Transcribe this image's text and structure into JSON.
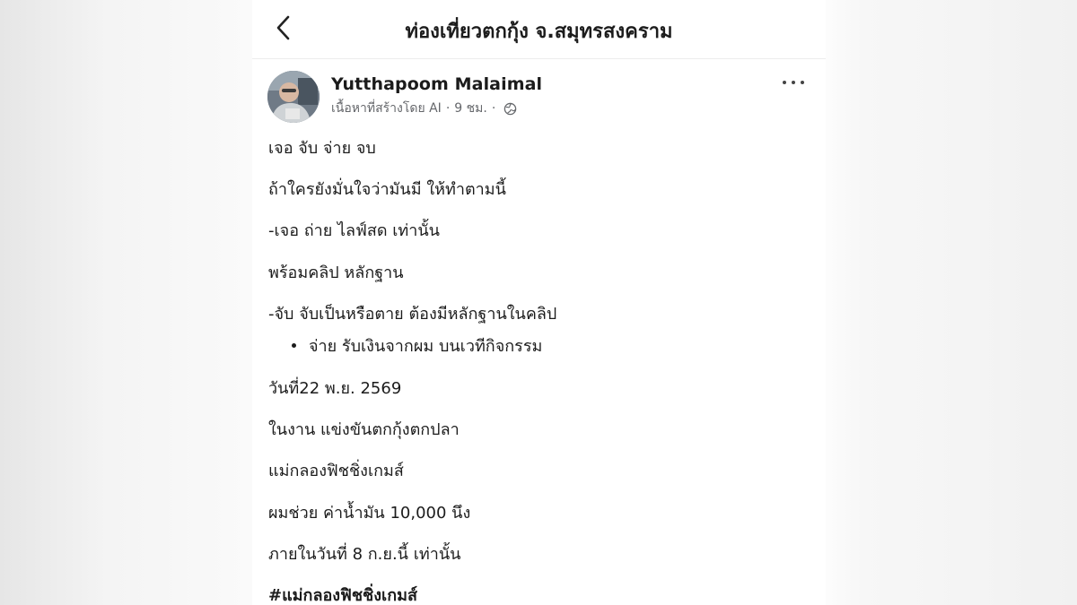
{
  "topbar": {
    "back_icon": "chevron-left-icon",
    "title": "ท่องเที่ยวตกกุ้ง จ.สมุทรสงคราม"
  },
  "post": {
    "author": "Yutthapoom Malaimal",
    "ai_label": "เนื้อหาที่สร้างโดย AI",
    "time": "9 ชม.",
    "separator": "·",
    "privacy_icon": "globe-icon",
    "more_icon": "more-horizontal-icon",
    "lines": [
      "เจอ  จับ  จ่าย  จบ",
      "ถ้าใครยังมั่นใจว่ามันมี  ให้ทำตามนี้",
      "-เจอ   ถ่าย ไลฟ์สด เท่านั้น",
      "พร้อมคลิป หลักฐาน",
      "-จับ    จับเป็นหรือตาย ต้องมีหลักฐานในคลิป",
      "จ่าย   รับเงินจากผม บนเวทีกิจกรรม",
      "วันที่22 พ.ย. 2569",
      "ในงาน แข่งขันตกกุ้งตกปลา",
      "แม่กลองฟิชชิ่งเกมส์",
      "ผมช่วย ค่าน้ำมัน 10,000 นึง",
      "ภายในวันที่ 8 ก.ย.นี้ เท่านั้น"
    ],
    "hashtag": "#แม่กลองฟิชชิ่งเกมส์"
  },
  "colors": {
    "text": "#1c1c1c",
    "meta": "#65676b",
    "page_bg": "#ffffff"
  }
}
